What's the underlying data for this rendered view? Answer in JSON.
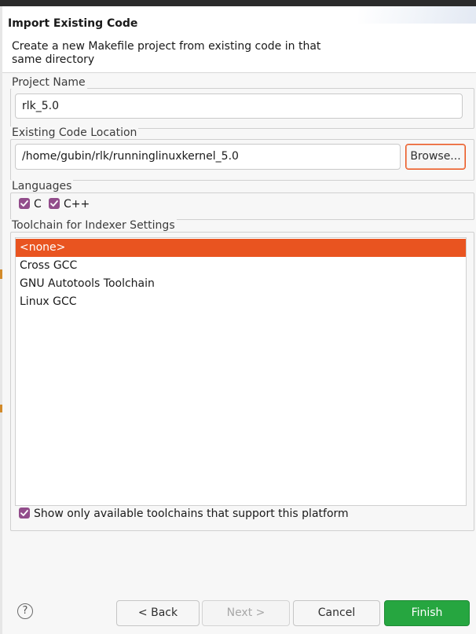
{
  "dialog": {
    "title": "Import Existing Code",
    "description": "Create a new Makefile project from existing code in that same directory"
  },
  "project_name": {
    "group_label": "Project Name",
    "value": "rlk_5.0"
  },
  "code_location": {
    "group_label": "Existing Code Location",
    "value": "/home/gubin/rlk/runninglinuxkernel_5.0",
    "browse_label": "Browse..."
  },
  "languages": {
    "group_label": "Languages",
    "items": [
      {
        "label": "C",
        "checked": true
      },
      {
        "label": "C++",
        "checked": true
      }
    ]
  },
  "toolchain": {
    "group_label": "Toolchain for Indexer Settings",
    "items": [
      {
        "label": "<none>",
        "selected": true
      },
      {
        "label": "Cross GCC",
        "selected": false
      },
      {
        "label": "GNU Autotools Toolchain",
        "selected": false
      },
      {
        "label": "Linux GCC",
        "selected": false
      }
    ],
    "show_only_available_label": "Show only available toolchains that support this platform",
    "show_only_available_checked": true
  },
  "buttons": {
    "help": "?",
    "back": "< Back",
    "next": "Next >",
    "cancel": "Cancel",
    "finish": "Finish"
  },
  "colors": {
    "accent": "#e95420",
    "checkbox": "#924d8b",
    "finish": "#26a640"
  }
}
